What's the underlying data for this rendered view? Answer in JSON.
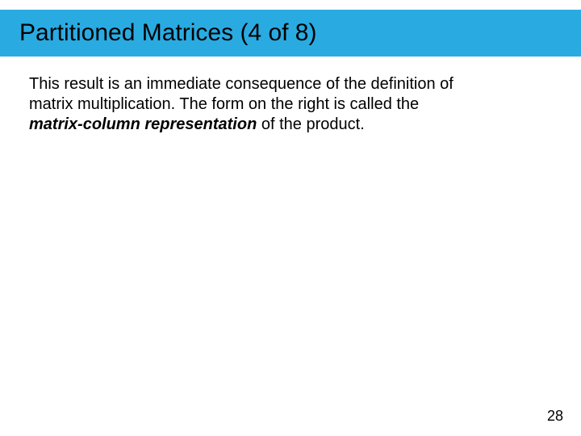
{
  "header": {
    "title": "Partitioned Matrices (4 of 8)"
  },
  "body": {
    "line1": "This result is an immediate consequence of the definition of",
    "line2a": "matrix multiplication. The form on the right is called the",
    "line3_bold": "matrix-column representation",
    "line3_rest": " of the product."
  },
  "footer": {
    "page": "28"
  }
}
